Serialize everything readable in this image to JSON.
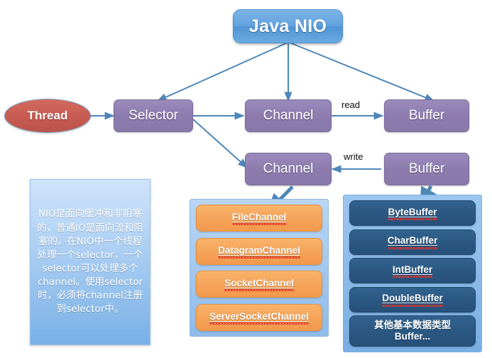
{
  "diagram": {
    "title": "Java NIO",
    "root": {
      "label": "Java NIO"
    },
    "thread": {
      "label": "Thread"
    },
    "nodes": {
      "selector": "Selector",
      "channel_read": "Channel",
      "buffer_read": "Buffer",
      "channel_write": "Channel",
      "buffer_write": "Buffer"
    },
    "edge_labels": {
      "read": "read",
      "write": "write"
    },
    "note": "NIO是面向缓冲和非阻塞的，普通IO是面向流和阻塞的。在NIO中一个线程处理一个selector，一个selector可以处理多个channel。使用selector时，必须将channel注册到selector中。",
    "channel_group": {
      "items": [
        "FileChannel",
        "DatagramChannel",
        "SocketChannel",
        "ServerSocketChannel"
      ]
    },
    "buffer_group": {
      "items": [
        "ByteBuffer",
        "CharBuffer",
        "IntBuffer",
        "DoubleBuffer"
      ],
      "last_item_line1": "其他基本数据类型",
      "last_item_line2": "Buffer..."
    },
    "colors": {
      "root_blue": "#62a3de",
      "thread_red": "#c85c52",
      "node_purple": "#8d7bae",
      "chip_orange": "#f5a45a",
      "chip_dark_blue": "#2b5882",
      "group_light_blue": "#a2c7ee",
      "arrow_blue": "#4e87b8",
      "note_text": "#ffffff"
    }
  }
}
